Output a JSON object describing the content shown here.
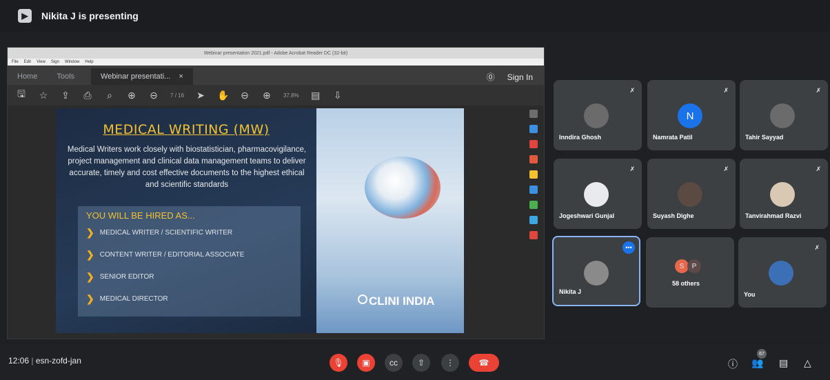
{
  "topbar": {
    "presenting": "Nikita J is presenting"
  },
  "acrobat": {
    "window_title": "Webinar presentation 2021.pdf - Adobe Acrobat Reader DC (32-bit)",
    "menu": [
      "File",
      "Edit",
      "View",
      "Sign",
      "Window",
      "Help"
    ],
    "tabs": {
      "home": "Home",
      "tools": "Tools",
      "doc": "Webinar presentati...",
      "close": "×"
    },
    "sign_in": "Sign In",
    "page_current": "7",
    "page_sep": "/ 16",
    "zoom": "37.8%"
  },
  "slide": {
    "title": "MEDICAL WRITING (MW)",
    "body": "Medical Writers work closely with biostatistician, pharmacovigilance, project management and clinical data management teams to deliver accurate, timely and cost effective documents to the highest ethical and scientific standards",
    "hired_title": "YOU WILL BE HIRED AS...",
    "hired_items": [
      "MEDICAL WRITER / SCIENTIFIC WRITER",
      "CONTENT WRITER / EDITORIAL ASSOCIATE",
      "SENIOR EDITOR",
      "MEDICAL DIRECTOR"
    ],
    "logo": "CLINI INDIA"
  },
  "participants": [
    {
      "name": "Inndira Ghosh",
      "initial": ""
    },
    {
      "name": "Namrata Patil",
      "initial": "N"
    },
    {
      "name": "Tahir Sayyad",
      "initial": ""
    },
    {
      "name": "Jogeshwari Gunjal",
      "initial": ""
    },
    {
      "name": "Suyash Dighe",
      "initial": ""
    },
    {
      "name": "Tanvirahmad Razvi",
      "initial": ""
    },
    {
      "name": "Nikita J",
      "initial": ""
    },
    {
      "name": "You",
      "initial": ""
    }
  ],
  "others": {
    "label": "58 others",
    "initials": [
      "S",
      "P"
    ]
  },
  "bottombar": {
    "time": "12:06",
    "meeting_code": "esn-zofd-jan",
    "people_count": "67"
  }
}
